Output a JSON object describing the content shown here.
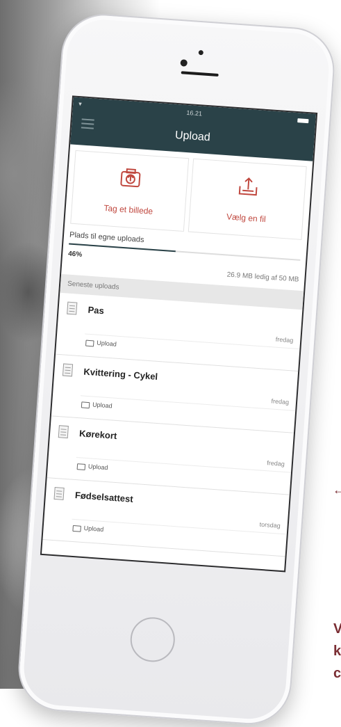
{
  "status": {
    "time": "16.21"
  },
  "header": {
    "title": "Upload"
  },
  "actions": [
    {
      "label": "Tag et billede",
      "icon": "camera-upload-icon"
    },
    {
      "label": "Vælg en fil",
      "icon": "file-upload-icon"
    }
  ],
  "storage": {
    "title": "Plads til egne uploads",
    "percent_label": "46%",
    "percent": 0.46,
    "free_text": "26.9 MB ledig af 50 MB"
  },
  "recent": {
    "header": "Seneste uploads",
    "items": [
      {
        "name": "Pas",
        "day": "fredag",
        "folder": "Upload"
      },
      {
        "name": "Kvittering - Cykel",
        "day": "fredag",
        "folder": "Upload"
      },
      {
        "name": "Kørekort",
        "day": "fredag",
        "folder": "Upload"
      },
      {
        "name": "Fødselsattest",
        "day": "torsdag",
        "folder": "Upload"
      }
    ]
  },
  "side_text": "V\nk\nc",
  "colors": {
    "navbar": "#2a4248",
    "accent": "#c0483f",
    "brand": "#7a2d33"
  }
}
